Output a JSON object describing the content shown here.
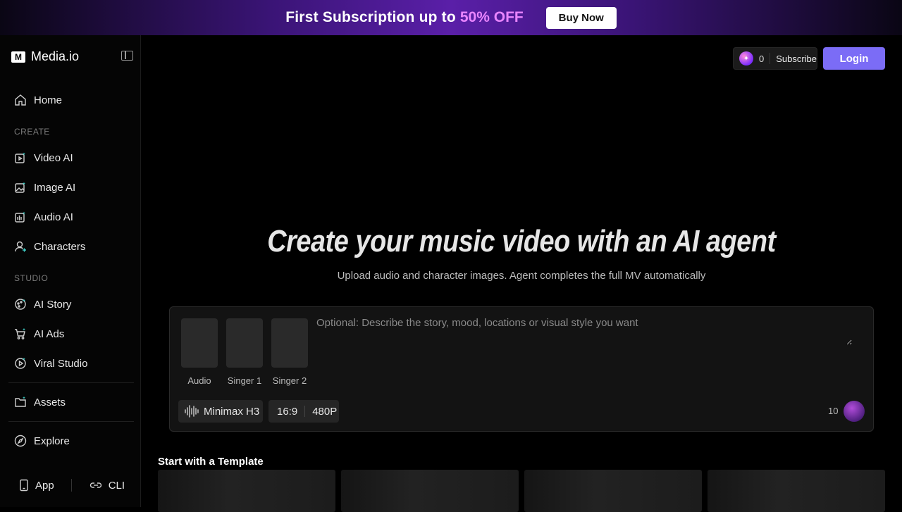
{
  "promo": {
    "text": "First Subscription up to",
    "highlight": "50% OFF",
    "button": "Buy Now"
  },
  "brand": {
    "logo_mark": "M",
    "name": "Media.io"
  },
  "sidebar": {
    "home": "Home",
    "create_label": "CREATE",
    "create_items": [
      "Video AI",
      "Image AI",
      "Audio AI",
      "Characters"
    ],
    "studio_label": "STUDIO",
    "studio_items": [
      "AI Story",
      "AI Ads",
      "Viral Studio"
    ],
    "assets": "Assets",
    "explore": "Explore",
    "bottom": {
      "app": "App",
      "cli": "CLI"
    }
  },
  "header": {
    "credits": "0",
    "subscribe": "Subscribe",
    "login": "Login"
  },
  "hero": {
    "title": "Create your music video with an AI agent",
    "subtitle": "Upload audio and character images. Agent completes the full MV automatically"
  },
  "composer": {
    "slots": [
      "Audio",
      "Singer 1",
      "Singer 2"
    ],
    "placeholder": "Optional: Describe the story, mood, locations or visual style you want",
    "model": "Minimax H3",
    "ratio": "16:9",
    "resolution": "480P",
    "cost": "10"
  },
  "templates": {
    "title": "Start with a Template"
  },
  "colors": {
    "accent": "#7b6cf6",
    "promo_highlight": "#e985ff",
    "background": "#000000"
  }
}
